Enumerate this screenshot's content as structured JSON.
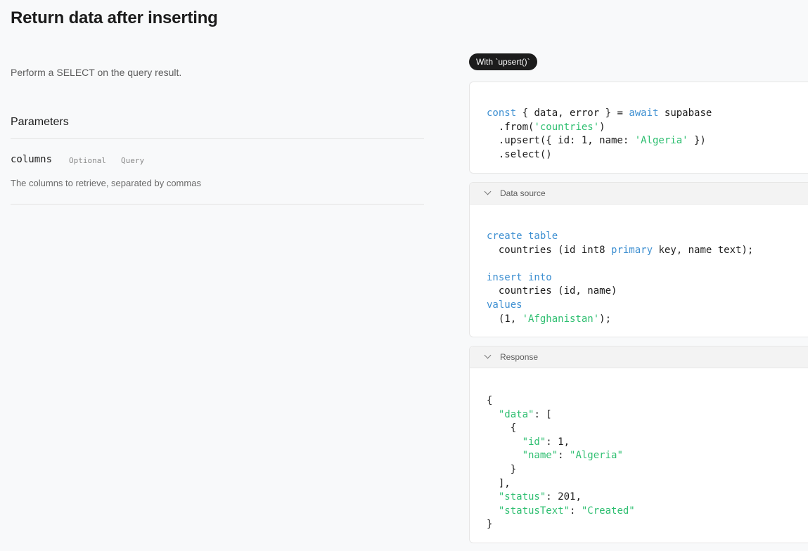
{
  "title": "Return data after inserting",
  "description": "Perform a SELECT on the query result.",
  "parameters": {
    "heading": "Parameters",
    "items": [
      {
        "name": "columns",
        "required": "Optional",
        "type": "Query",
        "description": "The columns to retrieve, separated by commas"
      }
    ]
  },
  "example": {
    "tab_label": "With `upsert()`",
    "code_lines": [
      [
        {
          "t": "const",
          "c": "kw"
        },
        {
          "t": " { data, error } = "
        },
        {
          "t": "await",
          "c": "kw"
        },
        {
          "t": " supabase"
        }
      ],
      [
        {
          "t": "  .from("
        },
        {
          "t": "'countries'",
          "c": "str"
        },
        {
          "t": ")"
        }
      ],
      [
        {
          "t": "  .upsert({ id: 1, name: "
        },
        {
          "t": "'Algeria'",
          "c": "str"
        },
        {
          "t": " })"
        }
      ],
      [
        {
          "t": "  .select()"
        }
      ]
    ]
  },
  "data_source": {
    "label": "Data source",
    "code_lines": [
      [
        {
          "t": "create table",
          "c": "kw"
        }
      ],
      [
        {
          "t": "  countries (id int8 "
        },
        {
          "t": "primary",
          "c": "kw"
        },
        {
          "t": " key, name text);"
        }
      ],
      [
        {
          "t": ""
        }
      ],
      [
        {
          "t": "insert into",
          "c": "kw"
        }
      ],
      [
        {
          "t": "  countries (id, name)"
        }
      ],
      [
        {
          "t": "values",
          "c": "kw"
        }
      ],
      [
        {
          "t": "  (1, "
        },
        {
          "t": "'Afghanistan'",
          "c": "str"
        },
        {
          "t": ");"
        }
      ]
    ]
  },
  "response": {
    "label": "Response",
    "code_lines": [
      [
        {
          "t": "{"
        }
      ],
      [
        {
          "t": "  "
        },
        {
          "t": "\"data\"",
          "c": "str"
        },
        {
          "t": ": ["
        }
      ],
      [
        {
          "t": "    {"
        }
      ],
      [
        {
          "t": "      "
        },
        {
          "t": "\"id\"",
          "c": "str"
        },
        {
          "t": ": 1,"
        }
      ],
      [
        {
          "t": "      "
        },
        {
          "t": "\"name\"",
          "c": "str"
        },
        {
          "t": ": "
        },
        {
          "t": "\"Algeria\"",
          "c": "str"
        }
      ],
      [
        {
          "t": "    }"
        }
      ],
      [
        {
          "t": "  ],"
        }
      ],
      [
        {
          "t": "  "
        },
        {
          "t": "\"status\"",
          "c": "str"
        },
        {
          "t": ": 201,"
        }
      ],
      [
        {
          "t": "  "
        },
        {
          "t": "\"statusText\"",
          "c": "str"
        },
        {
          "t": ": "
        },
        {
          "t": "\"Created\"",
          "c": "str"
        }
      ],
      [
        {
          "t": "}"
        }
      ]
    ]
  },
  "colors": {
    "keyword": "#3d8fd1",
    "string": "#2fbf71",
    "pill_bg": "#1c1c1c"
  }
}
